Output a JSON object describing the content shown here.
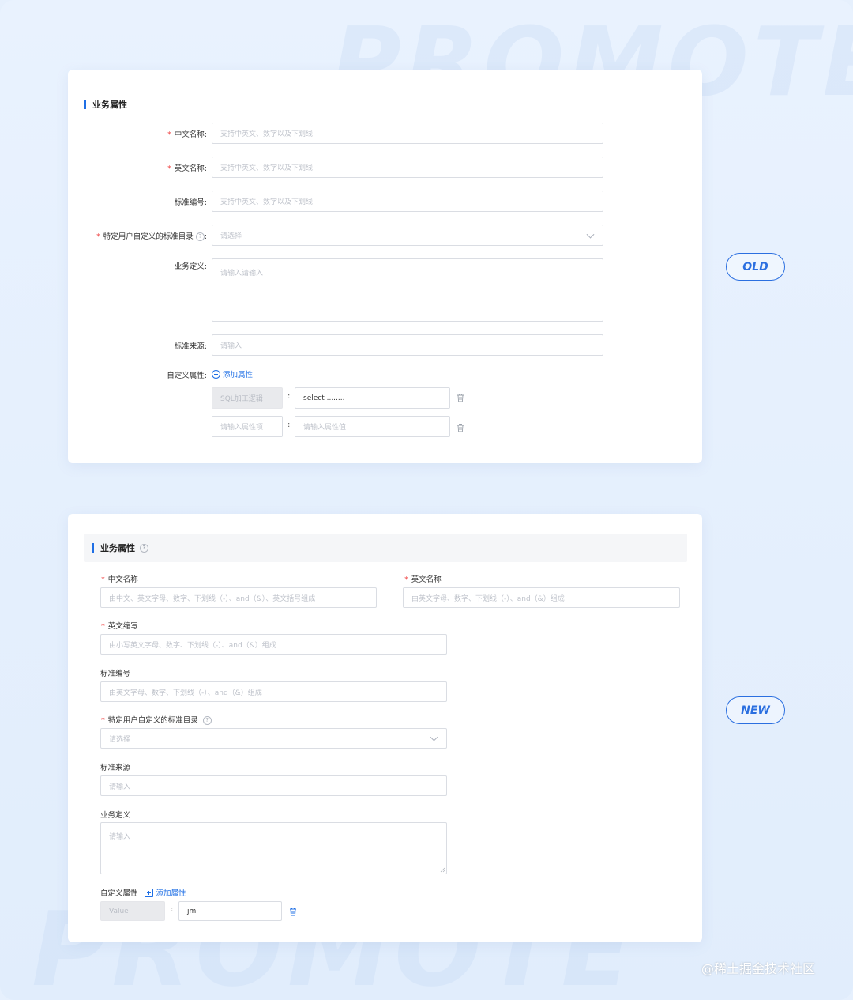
{
  "watermark": "PROMOTE",
  "old": {
    "badge": "OLD",
    "section_title": "业务属性",
    "fields": {
      "cn_name": {
        "label": "中文名称:",
        "placeholder": "支持中英文、数字以及下划线",
        "required": true
      },
      "en_name": {
        "label": "英文名称:",
        "placeholder": "支持中英文、数字以及下划线",
        "required": true
      },
      "std_code": {
        "label": "标准编号:",
        "placeholder": "支持中英文、数字以及下划线",
        "required": false
      },
      "std_dir": {
        "label": "特定用户自定义的标准目录",
        "colon": ":",
        "placeholder": "请选择",
        "required": true
      },
      "biz_def": {
        "label": "业务定义:",
        "placeholder": "请输入请输入",
        "required": false
      },
      "std_src": {
        "label": "标准来源:",
        "placeholder": "请输入",
        "required": false
      },
      "custom_attr": {
        "label": "自定义属性:",
        "add_link": "添加属性"
      }
    },
    "attr_rows": [
      {
        "key": "SQL加工逻辑",
        "value": "select ........",
        "sep": ":"
      },
      {
        "key_placeholder": "请输入属性项",
        "value_placeholder": "请输入属性值",
        "sep": ":"
      }
    ]
  },
  "new": {
    "badge": "NEW",
    "section_title": "业务属性",
    "fields": {
      "cn_name": {
        "label": "中文名称",
        "placeholder": "由中文、英文字母、数字、下划线（-）、and（&）、英文括号组成",
        "required": true
      },
      "en_name": {
        "label": "英文名称",
        "placeholder": "由英文字母、数字、下划线（-）、and（&）组成",
        "required": true
      },
      "en_abbr": {
        "label": "英文缩写",
        "placeholder": "由小写英文字母、数字、下划线（-）、and（&）组成",
        "required": true
      },
      "std_code": {
        "label": "标准编号",
        "placeholder": "由英文字母、数字、下划线（-）、and（&）组成",
        "required": false
      },
      "std_dir": {
        "label": "特定用户自定义的标准目录",
        "placeholder": "请选择",
        "required": true
      },
      "std_src": {
        "label": "标准来源",
        "placeholder": "请输入",
        "required": false
      },
      "biz_def": {
        "label": "业务定义",
        "placeholder": "请输入",
        "required": false
      },
      "custom_attr": {
        "label": "自定义属性",
        "add_link": "添加属性"
      }
    },
    "attr_rows": [
      {
        "key": "Value",
        "value": "jm",
        "sep": ":"
      }
    ]
  },
  "credit": "@稀土掘金技术社区",
  "colors": {
    "accent": "#1f6fe5",
    "required": "#f04a4a",
    "background": "#e6f0fd"
  },
  "icons": [
    "help-icon",
    "plus-circle-icon",
    "plus-square-icon",
    "trash-icon",
    "chevron-down-icon"
  ]
}
